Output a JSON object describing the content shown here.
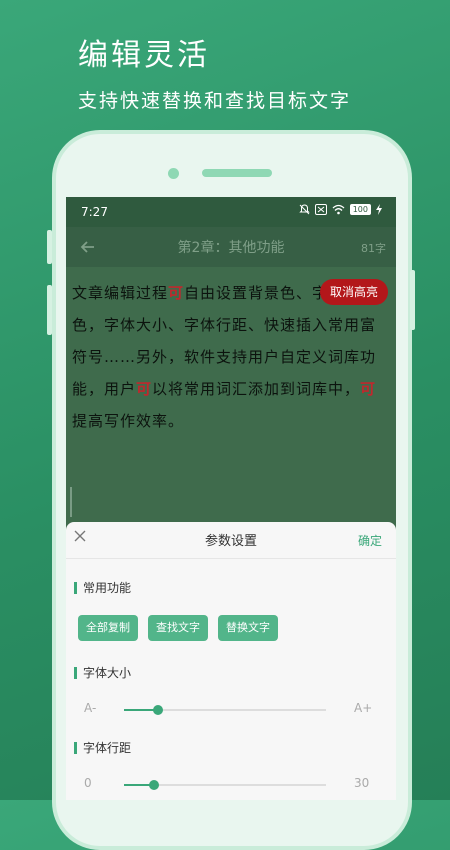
{
  "hero": {
    "title": "编辑灵活",
    "subtitle": "支持快速替换和查找目标文字"
  },
  "status_bar": {
    "time": "7:27",
    "battery": "100"
  },
  "header": {
    "chapter_title": "第2章：其他功能",
    "word_count": "81字"
  },
  "article": {
    "segments": [
      {
        "text": "文章编辑过程",
        "highlight": false
      },
      {
        "text": "可",
        "highlight": true
      },
      {
        "text": "自由设置背景色、字体颜色，字体大小、字体行距、快速插入常用富符号……另外，软件支持用户自定义词库功能，用户",
        "highlight": false
      },
      {
        "text": "可",
        "highlight": true
      },
      {
        "text": "以将常用词汇添加到词库中，",
        "highlight": false
      },
      {
        "text": "可",
        "highlight": true
      },
      {
        "text": "提高写作效率。",
        "highlight": false
      }
    ]
  },
  "cancel_highlight_label": "取消高亮",
  "sheet": {
    "title": "参数设置",
    "confirm": "确定",
    "common_label": "常用功能",
    "buttons": [
      "全部复制",
      "查找文字",
      "替换文字"
    ],
    "font_size": {
      "label": "字体大小",
      "min": "A-",
      "max": "A+",
      "value": 0.17
    },
    "line_spacing": {
      "label": "字体行距",
      "min": "0",
      "max": "30",
      "value": 0.15
    }
  },
  "colors": {
    "accent": "#3aa779",
    "highlight": "#c0282d",
    "cancel_button": "#b3171a"
  }
}
